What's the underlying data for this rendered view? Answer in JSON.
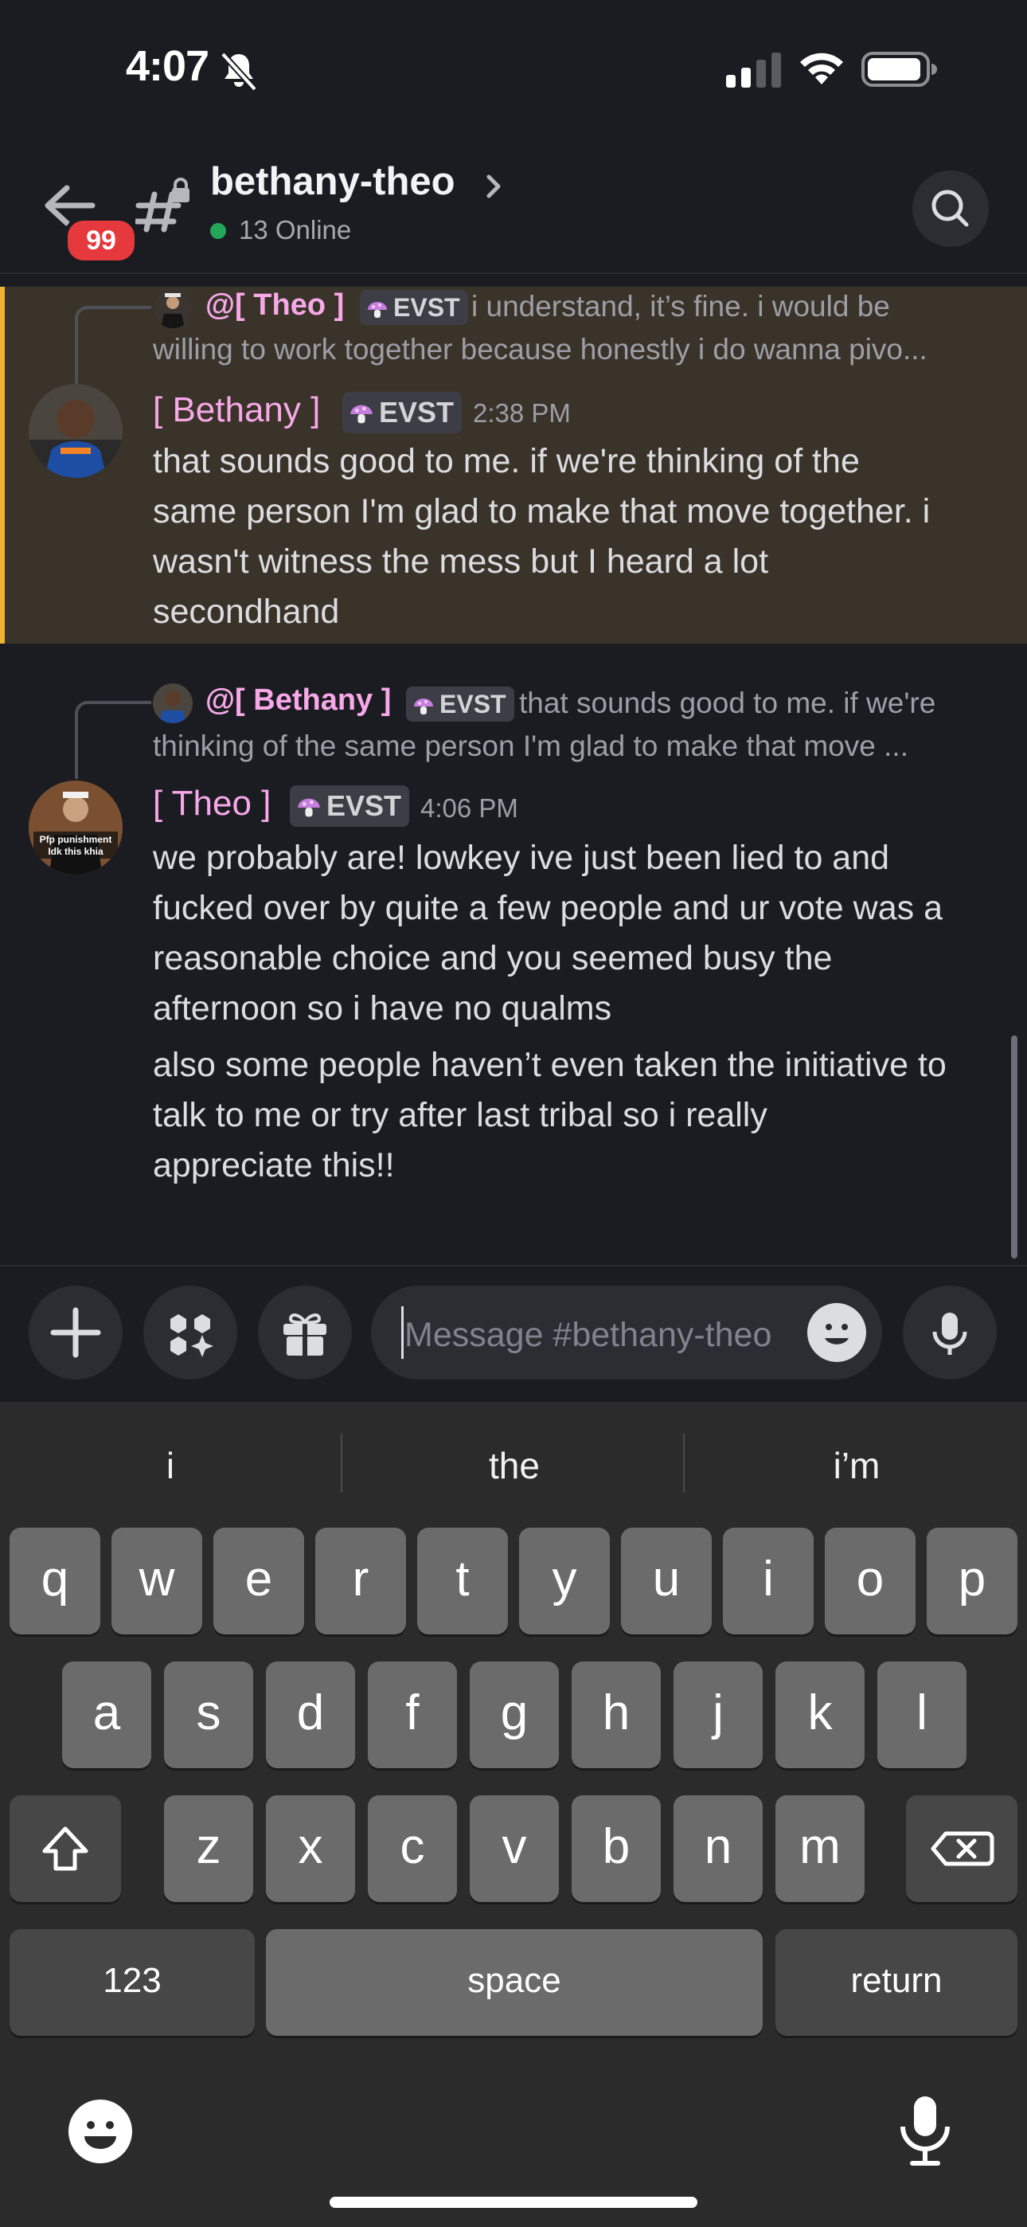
{
  "status_bar": {
    "time": "4:07"
  },
  "header": {
    "unread_badge": "99",
    "channel_name": "bethany-theo",
    "online_text": "13 Online"
  },
  "messages": [
    {
      "reply": {
        "name": "@[ Theo ]",
        "tag": "EVST",
        "text_line1": "i understand, it’s fine. i would be",
        "text_line2": "willing to work together because honestly i do wanna pivo..."
      },
      "author": "[ Bethany ]",
      "tag": "EVST",
      "time": "2:38 PM",
      "lines": [
        "that sounds good to me. if we're thinking of the",
        "same person I'm glad to make that move together. i",
        "wasn't witness the mess but I heard a lot",
        "secondhand"
      ]
    },
    {
      "reply": {
        "name": "@[ Bethany ]",
        "tag": "EVST",
        "text_line1": "that sounds good to me. if we're",
        "text_line2": "thinking of the same person I'm glad to make that move ..."
      },
      "author": "[ Theo ]",
      "tag": "EVST",
      "time": "4:06 PM",
      "avatar_caption_line1": "Pfp punishment",
      "avatar_caption_line2": "Idk this khia",
      "lines": [
        "we probably are! lowkey ive just been lied to and",
        "fucked over by quite a few people and ur vote was a",
        "reasonable choice and you seemed busy the",
        "afternoon so i have no qualms"
      ],
      "lines2": [
        "also some people haven’t even taken the initiative to",
        "talk to me or try after last tribal so i really",
        "appreciate this!!"
      ]
    }
  ],
  "composer": {
    "placeholder": "Message #bethany-theo"
  },
  "keyboard": {
    "suggestions": [
      "i",
      "the",
      "i’m"
    ],
    "row1": [
      "q",
      "w",
      "e",
      "r",
      "t",
      "y",
      "u",
      "i",
      "o",
      "p"
    ],
    "row2": [
      "a",
      "s",
      "d",
      "f",
      "g",
      "h",
      "j",
      "k",
      "l"
    ],
    "row3": [
      "z",
      "x",
      "c",
      "v",
      "b",
      "n",
      "m"
    ],
    "numbers_label": "123",
    "space_label": "space",
    "return_label": "return"
  },
  "colors": {
    "accent_name": "#f7a8e8",
    "highlight_bar": "#f0b232",
    "badge": "#e5393d",
    "online": "#23a55a"
  }
}
